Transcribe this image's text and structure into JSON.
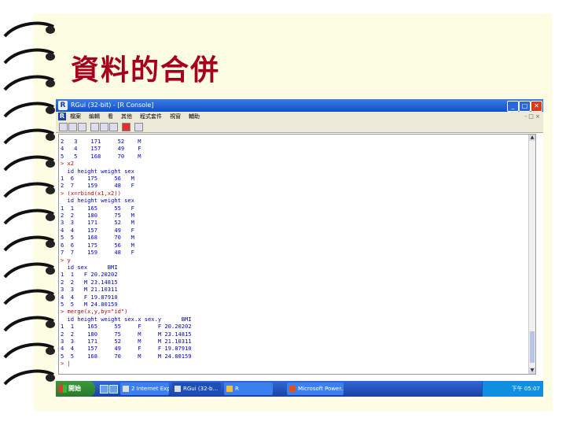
{
  "slide": {
    "title": "資料的合併"
  },
  "window": {
    "title": "RGui (32-bit) - [R Console]",
    "logo": "R",
    "buttons": {
      "minimize": "_",
      "maximize": "□",
      "close": "✕"
    }
  },
  "menu": {
    "logo": "R",
    "items": [
      "檔案",
      "編輯",
      "看",
      "其他",
      "程式套件",
      "視窗",
      "輔助"
    ],
    "mdi": "- □ ×"
  },
  "console": {
    "lines": [
      "2   3    171     52    M",
      "4   4    157     49    F",
      "5   5    168     70    M",
      "> x2",
      "  id height weight sex",
      "1  6    175     56   M",
      "2  7    159     48   F",
      "> (x=rbind(x1,x2))",
      "  id height weight sex",
      "1  1    165     55   F",
      "2  2    180     75   M",
      "3  3    171     52   M",
      "4  4    157     49   F",
      "5  5    168     70   M",
      "6  6    175     56   M",
      "7  7    159     48   F",
      "> y",
      "  id sex      BMI",
      "1  1   F 20.20202",
      "2  2   M 23.14815",
      "3  3   M 21.10311",
      "4  4   F 19.87910",
      "5  5   M 24.80159",
      "> merge(x,y,by=\"id\")",
      "  id height weight sex.x sex.y      BMI",
      "1  1    165     55     F     F 20.20202",
      "2  2    180     75     M     M 23.14815",
      "3  3    171     52     M     M 21.10311",
      "4  4    157     49     F     F 19.87910",
      "5  5    168     70     M     M 24.80159",
      "> |"
    ]
  },
  "taskbar": {
    "start": "開始",
    "tasks": [
      "2 Internet Exp...",
      "RGui (32-b...",
      "R",
      "Microsoft Power..."
    ],
    "clock": "下午 05:07"
  }
}
